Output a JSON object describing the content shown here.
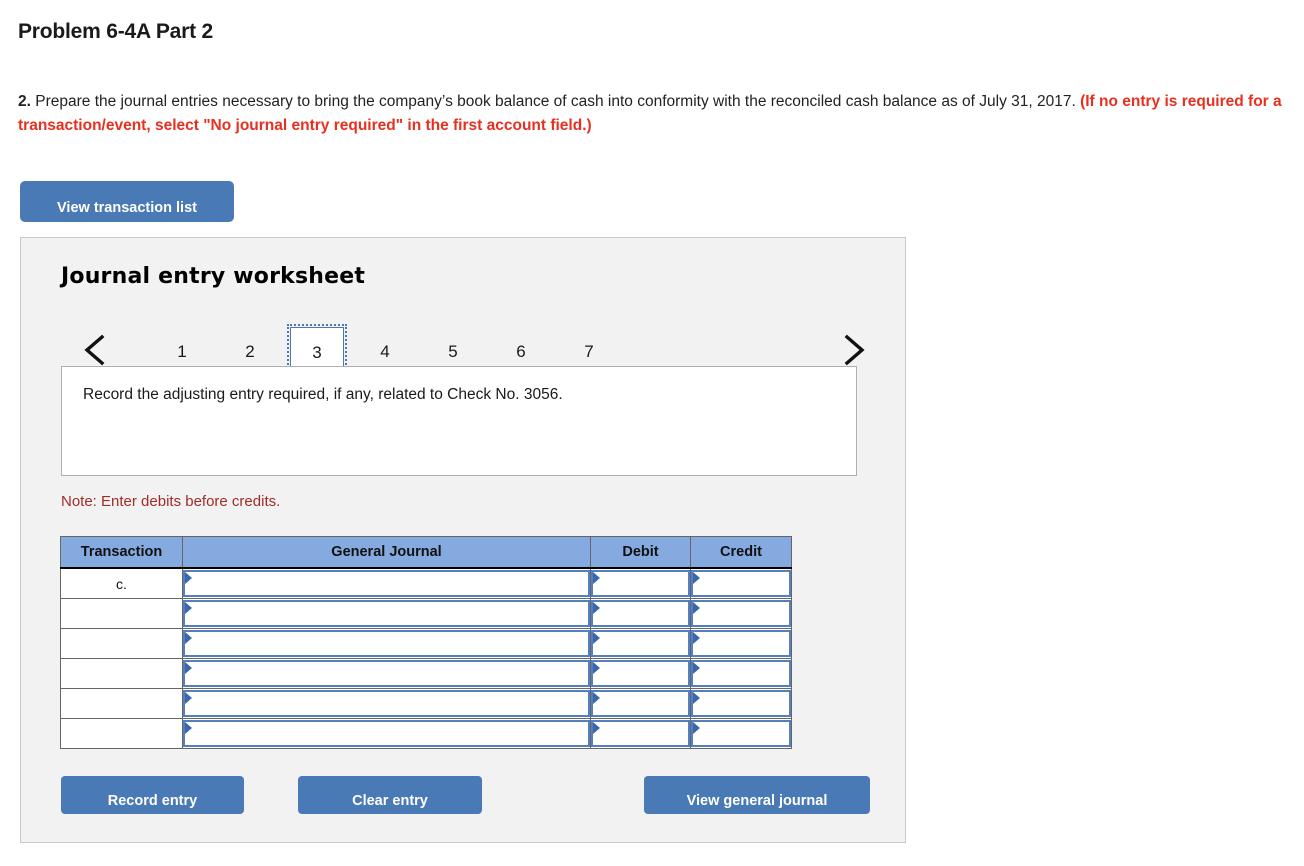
{
  "page_title": "Problem 6-4A Part 2",
  "prompt": {
    "number": "2.",
    "body": " Prepare the journal entries necessary to bring the company’s book balance of cash into conformity with the reconciled cash balance as of July 31, 2017. ",
    "red_note": "(If no entry is required for a transaction/event, select \"No journal entry required\" in the first account field.)"
  },
  "toolbar": {
    "view_transaction_list_label": "View transaction list"
  },
  "worksheet": {
    "title": "Journal entry worksheet",
    "prev_icon": "chevron-left-icon",
    "next_icon": "chevron-right-icon",
    "tabs": [
      "1",
      "2",
      "3",
      "4",
      "5",
      "6",
      "7"
    ],
    "active_tab": "3",
    "instruction": "Record the adjusting entry required, if any, related to Check No. 3056.",
    "note": "Note: Enter debits before credits."
  },
  "table": {
    "headers": [
      "Transaction",
      "General Journal",
      "Debit",
      "Credit"
    ],
    "rows": [
      {
        "transaction": "c.",
        "general_journal": "",
        "debit": "",
        "credit": ""
      },
      {
        "transaction": "",
        "general_journal": "",
        "debit": "",
        "credit": ""
      },
      {
        "transaction": "",
        "general_journal": "",
        "debit": "",
        "credit": ""
      },
      {
        "transaction": "",
        "general_journal": "",
        "debit": "",
        "credit": ""
      },
      {
        "transaction": "",
        "general_journal": "",
        "debit": "",
        "credit": ""
      },
      {
        "transaction": "",
        "general_journal": "",
        "debit": "",
        "credit": ""
      }
    ]
  },
  "actions": {
    "record_entry_label": "Record entry",
    "clear_entry_label": "Clear entry",
    "view_general_journal_label": "View general journal"
  },
  "colors": {
    "button_blue": "#4a7ab5",
    "header_blue": "#85aadf",
    "field_border_blue": "#5580c0",
    "red_text": "#e8301e",
    "note_red": "#9f2c26",
    "panel_bg": "#f2f2f2"
  }
}
